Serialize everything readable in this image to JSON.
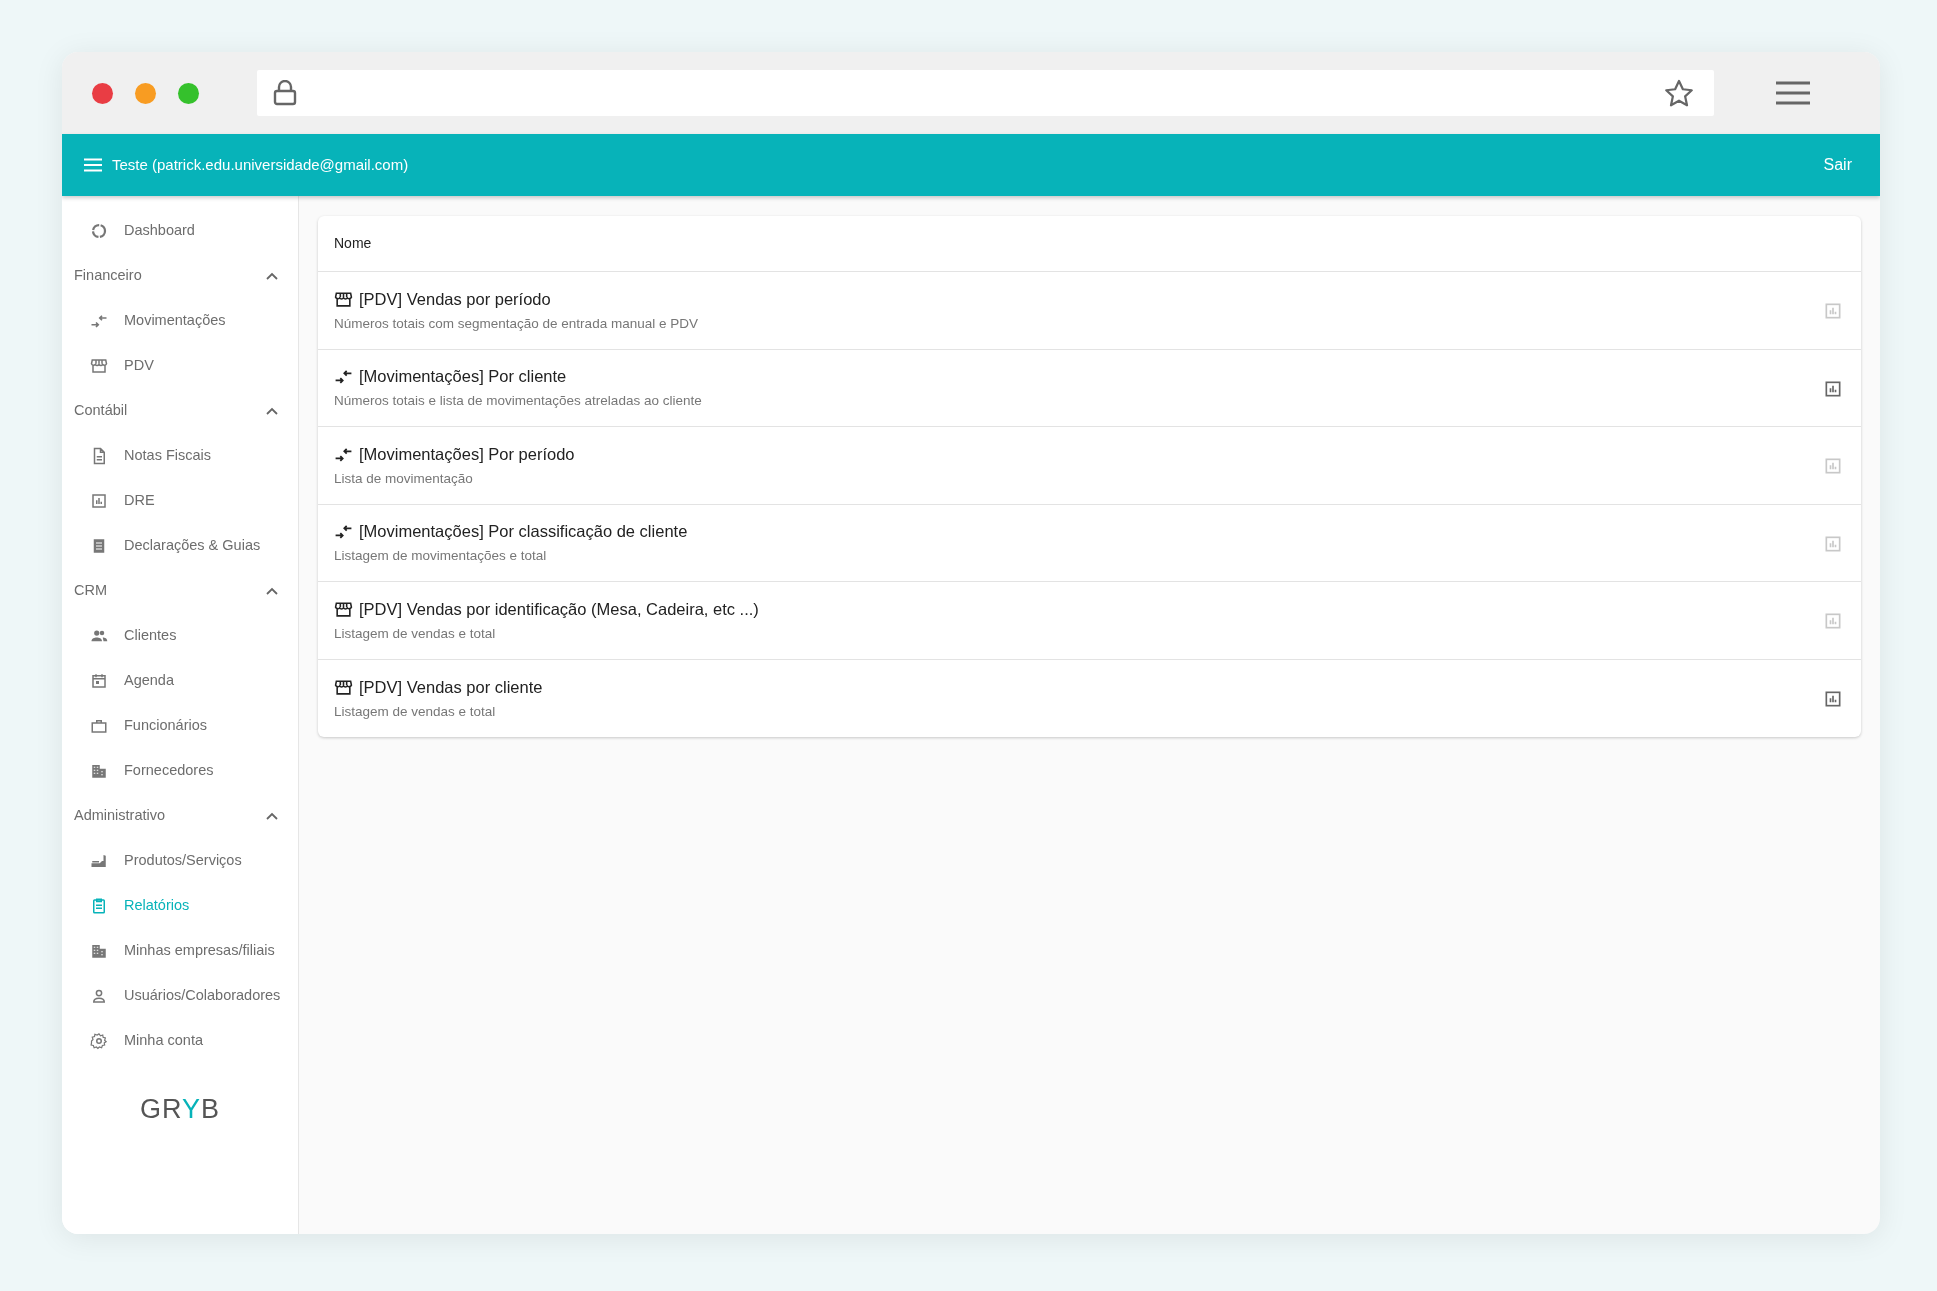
{
  "header": {
    "title": "Teste (patrick.edu.universidade@gmail.com)",
    "logout": "Sair"
  },
  "sidebar": {
    "items": [
      {
        "kind": "link",
        "label": "Dashboard",
        "selected": false
      },
      {
        "kind": "section",
        "label": "Financeiro",
        "expanded": true,
        "children": [
          {
            "label": "Movimentações",
            "selected": false
          },
          {
            "label": "PDV",
            "selected": false
          }
        ]
      },
      {
        "kind": "section",
        "label": "Contábil",
        "expanded": true,
        "children": [
          {
            "label": "Notas Fiscais",
            "selected": false
          },
          {
            "label": "DRE",
            "selected": false
          },
          {
            "label": "Declarações & Guias",
            "selected": false
          }
        ]
      },
      {
        "kind": "section",
        "label": "CRM",
        "expanded": true,
        "children": [
          {
            "label": "Clientes",
            "selected": false
          },
          {
            "label": "Agenda",
            "selected": false
          },
          {
            "label": "Funcionários",
            "selected": false
          },
          {
            "label": "Fornecedores",
            "selected": false
          }
        ]
      },
      {
        "kind": "section",
        "label": "Administrativo",
        "expanded": true,
        "children": [
          {
            "label": "Produtos/Serviços",
            "selected": false
          },
          {
            "label": "Relatórios",
            "selected": true
          },
          {
            "label": "Minhas empresas/filiais",
            "selected": false
          },
          {
            "label": "Usuários/Colaboradores",
            "selected": false
          },
          {
            "label": "Minha conta",
            "selected": false
          }
        ]
      }
    ],
    "logo": "GRYB"
  },
  "table": {
    "columns": [
      "Nome"
    ],
    "rows": [
      {
        "kind": "pdv",
        "title": "[PDV] Vendas por período",
        "description": "Números totais com segmentação de entrada manual e PDV",
        "disabled": true
      },
      {
        "kind": "movimentacoes",
        "title": "[Movimentações] Por cliente",
        "description": "Números totais e lista de movimentações atreladas ao cliente",
        "disabled": false
      },
      {
        "kind": "movimentacoes",
        "title": "[Movimentações] Por período",
        "description": "Lista de movimentação",
        "disabled": true
      },
      {
        "kind": "movimentacoes",
        "title": "[Movimentações] Por classificação de cliente",
        "description": "Listagem de movimentações e total",
        "disabled": true
      },
      {
        "kind": "pdv",
        "title": "[PDV] Vendas por identificação (Mesa, Cadeira, etc ...)",
        "description": "Listagem de vendas e total",
        "disabled": true
      },
      {
        "kind": "pdv",
        "title": "[PDV] Vendas por cliente",
        "description": "Listagem de vendas e total",
        "disabled": false
      }
    ]
  }
}
